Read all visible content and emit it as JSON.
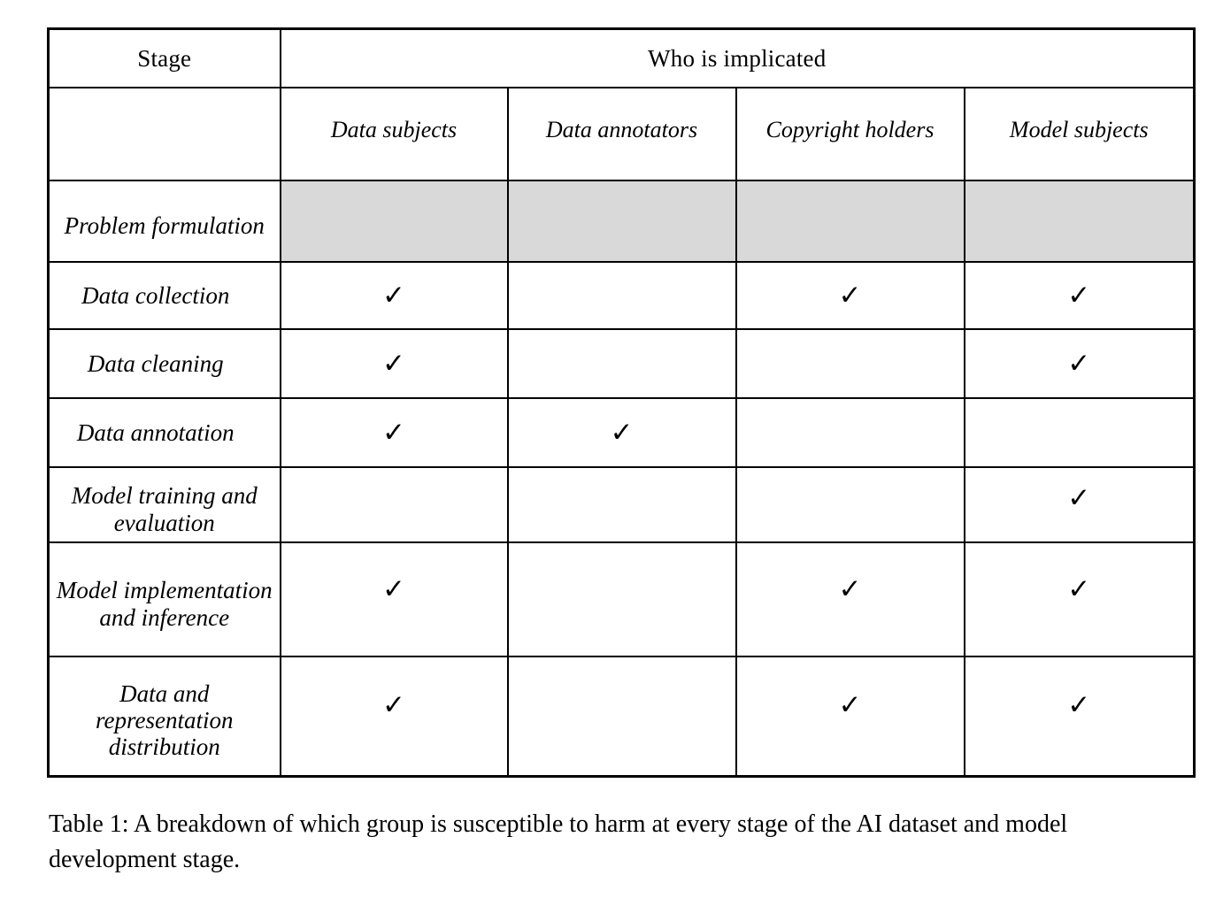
{
  "table": {
    "header": {
      "stage_label": "Stage",
      "group_label": "Who is implicated",
      "columns": [
        "Data subjects",
        "Data annotators",
        "Copyright holders",
        "Model subjects"
      ]
    },
    "check_glyph": "✓",
    "shade_color": "#d9d9d9",
    "rows": [
      {
        "stage": "Problem formulation",
        "multiline": true,
        "shaded": true,
        "marks": [
          false,
          false,
          false,
          false
        ]
      },
      {
        "stage": "Data collection",
        "multiline": false,
        "shaded": false,
        "marks": [
          true,
          false,
          true,
          true
        ]
      },
      {
        "stage": "Data cleaning",
        "multiline": false,
        "shaded": false,
        "marks": [
          true,
          false,
          false,
          true
        ]
      },
      {
        "stage": "Data annotation",
        "multiline": false,
        "shaded": false,
        "marks": [
          true,
          true,
          false,
          false
        ]
      },
      {
        "stage": "Model training and evaluation",
        "multiline": true,
        "shaded": false,
        "marks": [
          false,
          false,
          false,
          true
        ]
      },
      {
        "stage": "Model implementation and inference",
        "multiline": true,
        "shaded": false,
        "marks": [
          true,
          false,
          true,
          true
        ]
      },
      {
        "stage": "Data and representation distribution",
        "multiline": true,
        "shaded": false,
        "marks": [
          true,
          false,
          true,
          true
        ]
      }
    ]
  },
  "caption": "Table 1: A breakdown of which group is susceptible to harm at every stage of the AI dataset and model development stage."
}
